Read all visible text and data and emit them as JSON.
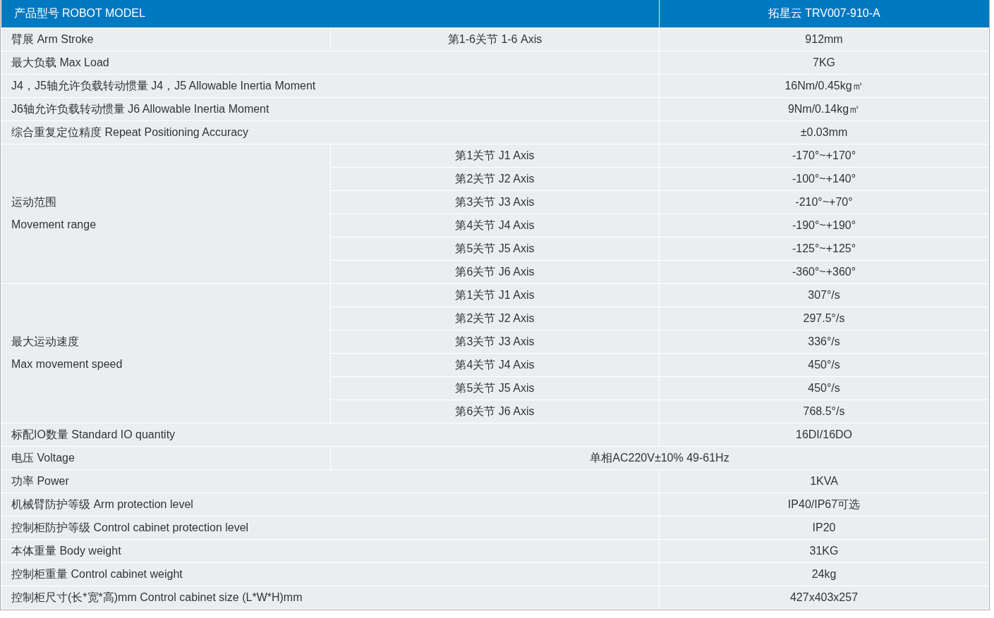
{
  "header": {
    "label": "产品型号 ROBOT MODEL",
    "value": "拓星云 TRV007-910-A"
  },
  "rows": [
    {
      "kind": "axis",
      "label": "臂展 Arm Stroke",
      "axis": "第1-6关节 1-6 Axis",
      "value": "912mm"
    },
    {
      "kind": "single",
      "label": "最大负载 Max Load",
      "value": "7KG"
    },
    {
      "kind": "single",
      "label": "J4，J5轴允许负载转动惯量 J4，J5 Allowable Inertia Moment",
      "value": "16Nm/0.45kg㎡"
    },
    {
      "kind": "single",
      "label": "J6轴允许负载转动惯量 J6 Allowable Inertia Moment",
      "value": "9Nm/0.14kg㎡"
    },
    {
      "kind": "single",
      "label": "综合重复定位精度 Repeat Positioning Accuracy",
      "value": "±0.03mm"
    },
    {
      "kind": "group",
      "label_lines": [
        "运动范围",
        "Movement range"
      ],
      "items": [
        {
          "axis": "第1关节 J1 Axis",
          "value": "-170°~+170°"
        },
        {
          "axis": "第2关节 J2 Axis",
          "value": "-100°~+140°"
        },
        {
          "axis": "第3关节 J3 Axis",
          "value": "-210°~+70°"
        },
        {
          "axis": "第4关节 J4 Axis",
          "value": "-190°~+190°"
        },
        {
          "axis": "第5关节 J5 Axis",
          "value": "-125°~+125°"
        },
        {
          "axis": "第6关节 J6 Axis",
          "value": "-360°~+360°"
        }
      ]
    },
    {
      "kind": "group",
      "label_lines": [
        "最大运动速度",
        "Max movement speed"
      ],
      "items": [
        {
          "axis": "第1关节 J1 Axis",
          "value": "307°/s"
        },
        {
          "axis": "第2关节 J2 Axis",
          "value": "297.5°/s"
        },
        {
          "axis": "第3关节 J3 Axis",
          "value": "336°/s"
        },
        {
          "axis": "第4关节 J4 Axis",
          "value": "450°/s"
        },
        {
          "axis": "第5关节 J5 Axis",
          "value": "450°/s"
        },
        {
          "axis": "第6关节 J6 Axis",
          "value": "768.5°/s"
        }
      ]
    },
    {
      "kind": "single",
      "label": "标配IO数量 Standard IO quantity",
      "value": "16DI/16DO"
    },
    {
      "kind": "wide",
      "label": "电压 Voltage",
      "value": "单相AC220V±10% 49-61Hz"
    },
    {
      "kind": "single",
      "label": "功率 Power",
      "value": "1KVA"
    },
    {
      "kind": "single",
      "label": "机械臂防护等级 Arm protection level",
      "value": "IP40/IP67可选"
    },
    {
      "kind": "single",
      "label": "控制柜防护等级 Control cabinet protection level",
      "value": "IP20"
    },
    {
      "kind": "single",
      "label": "本体重量 Body weight",
      "value": "31KG"
    },
    {
      "kind": "single",
      "label": "控制柜重量 Control cabinet weight",
      "value": "24kg"
    },
    {
      "kind": "single",
      "label": "控制柜尺寸(长*宽*高)mm Control cabinet size (L*W*H)mm",
      "value": "427x403x257"
    }
  ]
}
